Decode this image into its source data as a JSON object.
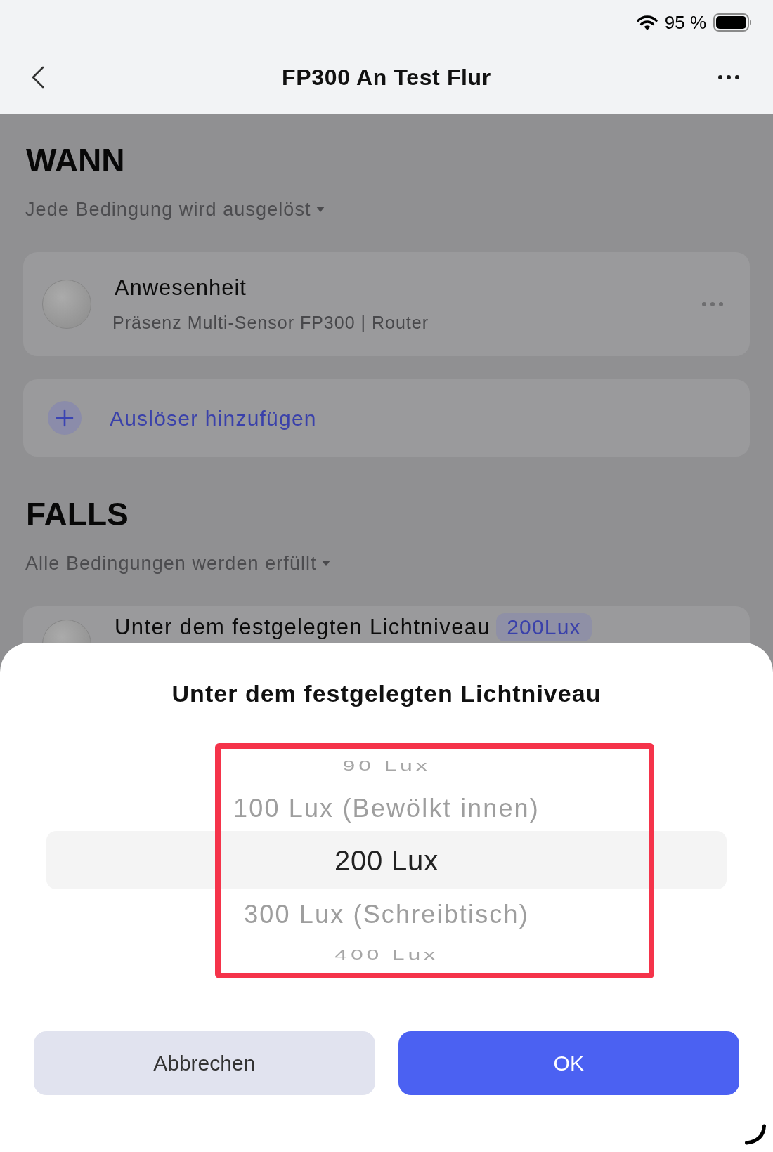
{
  "status_bar": {
    "battery_text": "95 %"
  },
  "nav_bar": {
    "title": "FP300 An Test Flur"
  },
  "sections": [
    {
      "heading": "WANN",
      "mode": "Jede Bedingung wird ausgelöst",
      "cards": [
        {
          "kind": "device",
          "title": "Anwesenheit",
          "subtitle": "Präsenz Multi-Sensor FP300 | Router"
        },
        {
          "kind": "add",
          "label": "Auslöser hinzufügen"
        }
      ]
    },
    {
      "heading": "FALLS",
      "mode": "Alle Bedingungen werden erfüllt",
      "cards": [
        {
          "kind": "condition",
          "title": "Unter dem festgelegten Lichtniveau",
          "badge": "200Lux"
        }
      ]
    }
  ],
  "sheet": {
    "title": "Unter dem festgelegten Lichtniveau",
    "options": [
      {
        "label": "90 Lux",
        "selected": false
      },
      {
        "label": "100 Lux (Bewölkt innen)",
        "selected": false
      },
      {
        "label": "200 Lux",
        "selected": true
      },
      {
        "label": "300 Lux (Schreibtisch)",
        "selected": false
      },
      {
        "label": "400 Lux",
        "selected": false
      }
    ],
    "buttons": [
      {
        "label": "Abbrechen",
        "kind": "secondary"
      },
      {
        "label": "OK",
        "kind": "primary"
      }
    ]
  }
}
